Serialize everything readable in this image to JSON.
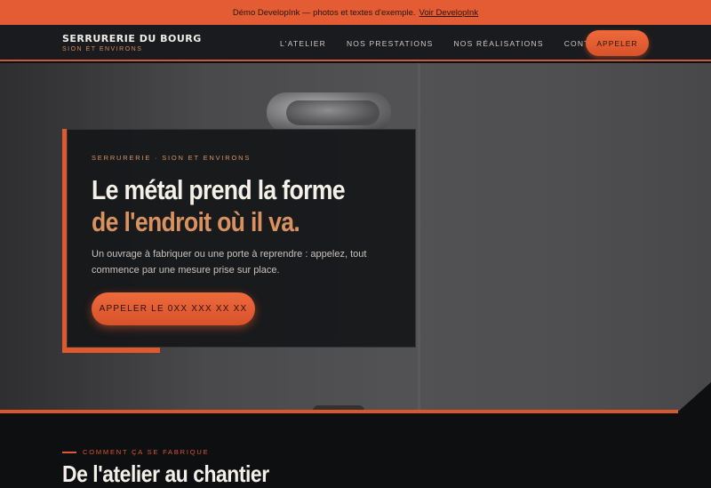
{
  "demo_bar": {
    "text": "Démo DevelopInk — photos et textes d'exemple.",
    "link": "Voir DevelopInk"
  },
  "nav": {
    "brand_name": "SERRURERIE DU BOURG",
    "brand_sub": "SION ET ENVIRONS",
    "links": [
      "L'ATELIER",
      "NOS PRESTATIONS",
      "NOS RÉALISATIONS",
      "CONTACT"
    ],
    "cta": "APPELER"
  },
  "hero": {
    "eyebrow": "SERRURERIE · SION ET ENVIRONS",
    "headline_line1": "Le métal prend la forme",
    "headline_line2": "de l'endroit où il va.",
    "lede": "Un ouvrage à fabriquer ou une porte à reprendre : appelez, tout commence par une mesure prise sur place.",
    "cta": "APPELER LE 0XX XXX XX XX"
  },
  "section": {
    "label": "COMMENT ÇA SE FABRIQUE",
    "title": "De l'atelier au chantier"
  },
  "colors": {
    "accent": "#e35c33",
    "accent_soft": "#d9925f",
    "nav_bg": "#1a1b1e",
    "page_bg": "#0e0f11"
  }
}
